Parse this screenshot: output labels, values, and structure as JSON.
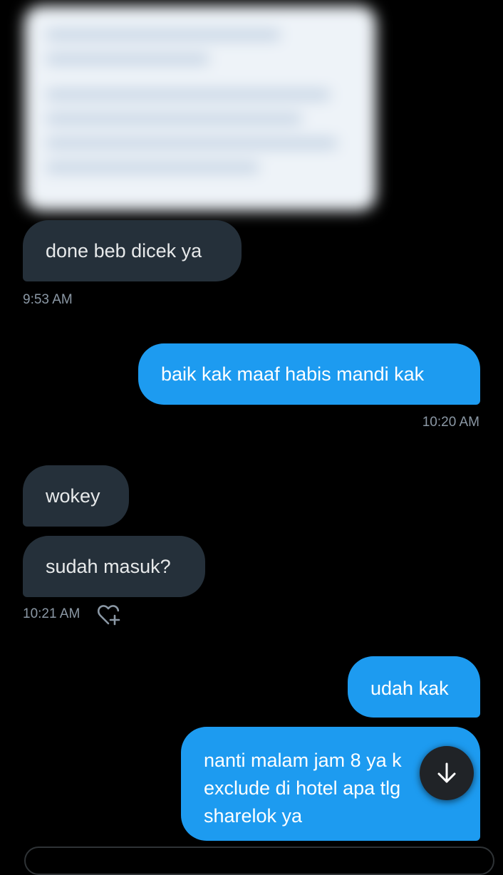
{
  "messages": [
    {
      "id": "m1",
      "direction": "incoming",
      "text": "done beb dicek ya"
    },
    {
      "id": "m2",
      "direction": "outgoing",
      "text": "baik kak maaf habis mandi kak"
    },
    {
      "id": "m3",
      "direction": "incoming",
      "text": "wokey"
    },
    {
      "id": "m4",
      "direction": "incoming",
      "text": "sudah masuk?"
    },
    {
      "id": "m5",
      "direction": "outgoing",
      "text": "udah kak"
    },
    {
      "id": "m6",
      "direction": "outgoing",
      "lines": [
        "nanti malam jam 8 ya k",
        "exclude di hotel apa tlg",
        "sharelok ya"
      ]
    }
  ],
  "timestamps": {
    "t1": "9:53 AM",
    "t2": "10:20 AM",
    "t3": "10:21 AM"
  },
  "icons": {
    "react": "heart-plus-icon",
    "scroll": "arrow-down-icon"
  },
  "colors": {
    "background": "#000000",
    "incoming_bubble": "#25303a",
    "outgoing_bubble": "#1d9bf0",
    "timestamp": "#8b98a5"
  }
}
